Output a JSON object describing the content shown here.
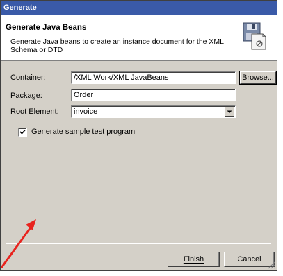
{
  "window": {
    "title": "Generate"
  },
  "banner": {
    "title": "Generate Java Beans",
    "description": "Generate Java beans to create an instance document for the XML Schema or DTD",
    "icon": "floppy-disk-document-icon"
  },
  "form": {
    "container_label": "Container:",
    "container_value": "/XML Work/XML JavaBeans",
    "browse_label": "Browse...",
    "package_label": "Package:",
    "package_value": "Order",
    "root_element_label": "Root Element:",
    "root_element_value": "invoice",
    "checkbox_label": "Generate sample test program",
    "checkbox_checked": true
  },
  "buttons": {
    "finish_label": "Finish",
    "cancel_label": "Cancel"
  },
  "annotation": {
    "arrow_color": "#e8231e",
    "icon": "red-arrow-icon"
  }
}
